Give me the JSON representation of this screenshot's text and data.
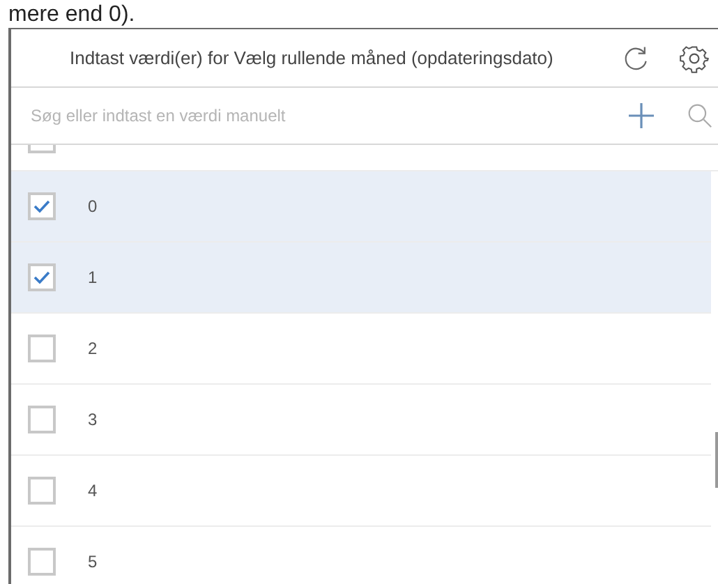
{
  "top_text": "mere end 0).",
  "header": {
    "title": "Indtast værdi(er) for Vælg rullende måned (opdateringsdato)"
  },
  "search": {
    "placeholder": "Søg eller indtast en værdi manuelt"
  },
  "items": [
    {
      "label": "0",
      "checked": true
    },
    {
      "label": "1",
      "checked": true
    },
    {
      "label": "2",
      "checked": false
    },
    {
      "label": "3",
      "checked": false
    },
    {
      "label": "4",
      "checked": false
    },
    {
      "label": "5",
      "checked": false
    }
  ]
}
